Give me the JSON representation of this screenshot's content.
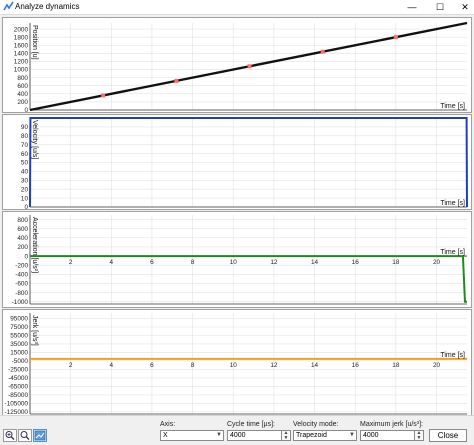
{
  "window": {
    "title": "Analyze dynamics",
    "icon": "app-chart-icon",
    "controls": {
      "minimize": "—",
      "maximize": "☐",
      "close": "✕"
    }
  },
  "chart_data": [
    {
      "type": "line",
      "ylabel": "Position [u]",
      "xlabel": "Time [s]",
      "yticks": [
        0,
        200,
        400,
        600,
        800,
        1000,
        1200,
        1400,
        1600,
        1800,
        2000
      ],
      "ylim": [
        0,
        2150
      ],
      "xlim": [
        0,
        21.5
      ],
      "grid": true,
      "series": [
        {
          "color": "#111111",
          "x": [
            0,
            21.5
          ],
          "y": [
            0,
            2150
          ]
        }
      ],
      "markers": {
        "color": "#ff6b6b",
        "x": [
          3.6,
          7.2,
          10.8,
          14.4,
          18.0
        ],
        "y": [
          360,
          720,
          1080,
          1440,
          1800
        ]
      }
    },
    {
      "type": "line",
      "ylabel": "Velocity [u/s]",
      "xlabel": "Time [s]",
      "yticks": [
        0,
        10,
        20,
        30,
        40,
        50,
        60,
        70,
        80,
        90
      ],
      "ylim": [
        0,
        100
      ],
      "xlim": [
        0,
        21.5
      ],
      "grid": true,
      "series": [
        {
          "color": "#1f3fbf",
          "x": [
            0,
            0.02,
            21.48,
            21.5
          ],
          "y": [
            0,
            100,
            100,
            0
          ]
        }
      ]
    },
    {
      "type": "line",
      "ylabel": "Acceleration [u/s²]",
      "xlabel": "Time [s]",
      "yticks": [
        -1000,
        -800,
        -600,
        -400,
        -200,
        0,
        200,
        400,
        600,
        800
      ],
      "xticks": [
        2,
        4,
        6,
        8,
        10,
        12,
        14,
        16,
        18,
        20
      ],
      "ylim": [
        -1050,
        900
      ],
      "xlim": [
        0,
        21.5
      ],
      "grid": true,
      "series": [
        {
          "color": "#1e8a1e",
          "x": [
            0,
            21.3,
            21.4,
            21.5
          ],
          "y": [
            0,
            0,
            -1000,
            -1000
          ]
        }
      ]
    },
    {
      "type": "line",
      "ylabel": "Jerk [u/s³]",
      "xlabel": "Time [s]",
      "yticks": [
        -125000,
        -105000,
        -85000,
        -65000,
        -45000,
        -25000,
        -5000,
        15000,
        35000,
        55000,
        75000,
        95000
      ],
      "xticks": [
        2,
        4,
        6,
        8,
        10,
        12,
        14,
        16,
        18,
        20
      ],
      "ylim": [
        -130000,
        108000
      ],
      "xlim": [
        0,
        21.5
      ],
      "grid": true,
      "series": [
        {
          "color": "#f0a020",
          "x": [
            0,
            21.5
          ],
          "y": [
            0,
            0
          ]
        }
      ]
    }
  ],
  "toolbar": {
    "buttons": [
      {
        "name": "zoom-in-button",
        "icon": "magnifier-plus-icon"
      },
      {
        "name": "zoom-out-button",
        "icon": "magnifier-icon"
      },
      {
        "name": "fit-view-button",
        "icon": "chart-view-icon"
      }
    ]
  },
  "controls": {
    "axis": {
      "label": "Axis:",
      "value": "X"
    },
    "cycle_time": {
      "label": "Cycle time [µs]:",
      "value": "4000"
    },
    "velocity_mode": {
      "label": "Velocity mode:",
      "value": "Trapezoid"
    },
    "max_jerk": {
      "label": "Maximum jerk [u/s³]:",
      "value": "4000"
    },
    "close_label": "Close"
  },
  "colors": {
    "position_line": "#111111",
    "velocity_line": "#1f3fbf",
    "acceleration_line": "#1e8a1e",
    "jerk_line": "#f0a020",
    "marker": "#ff6b6b"
  }
}
